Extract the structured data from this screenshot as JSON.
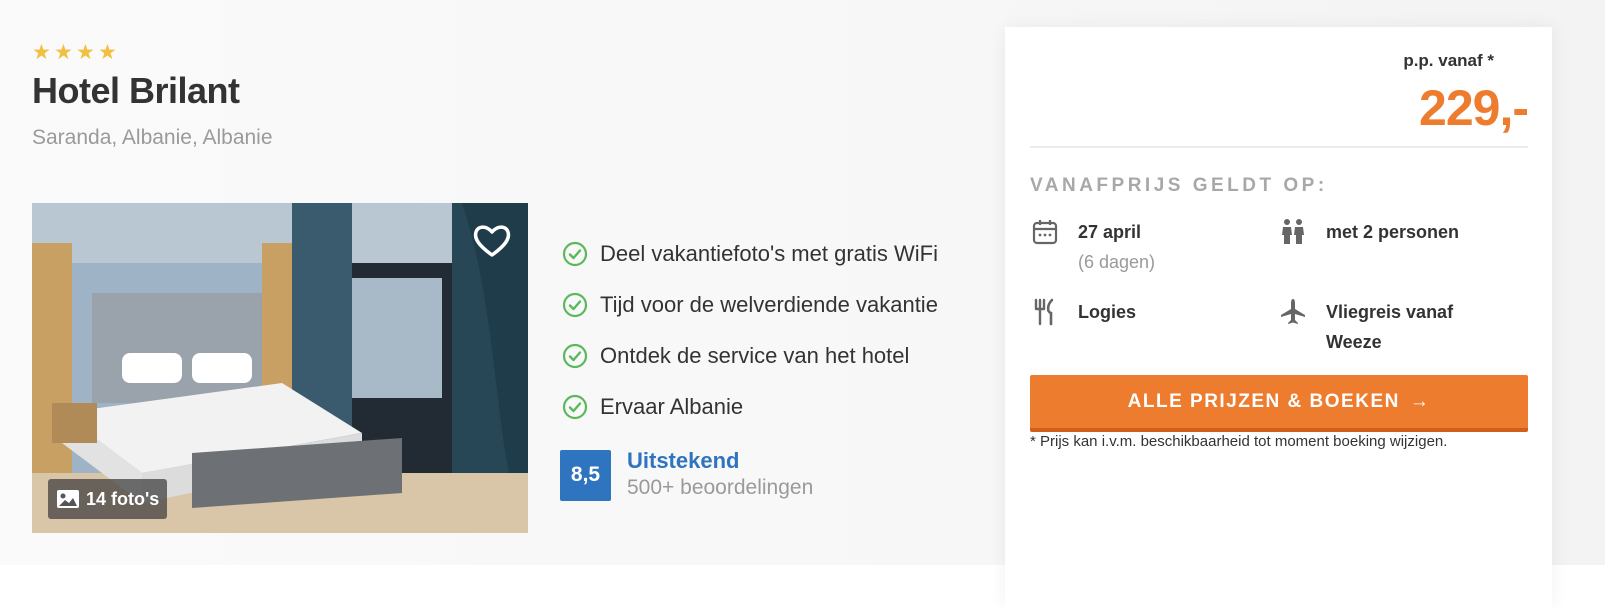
{
  "hotel": {
    "stars": 4,
    "name": "Hotel Brilant",
    "location": "Saranda, Albanie, Albanie",
    "photos_label": "14 foto's"
  },
  "features": [
    {
      "text": "Deel vakantiefoto's met gratis WiFi"
    },
    {
      "text": "Tijd voor de welverdiende vakantie"
    },
    {
      "text": "Ontdek de service van het hotel"
    },
    {
      "text": "Ervaar Albanie"
    }
  ],
  "rating": {
    "score": "8,5",
    "label": "Uitstekend",
    "count": "500+ beoordelingen"
  },
  "price_card": {
    "per_person": "p.p. vanaf *",
    "price": "229,-",
    "applies_heading": "VANAFPRIJS GELDT OP:",
    "date": "27 april",
    "duration": "(6 dagen)",
    "persons": "met 2 personen",
    "board": "Logies",
    "flight": "Vliegreis vanaf",
    "flight_origin": "Weeze",
    "book_label": "ALLE PRIJZEN & BOEKEN",
    "disclaimer": "* Prijs kan i.v.m. beschikbaarheid tot moment boeking wijzigen."
  },
  "colors": {
    "accent": "#ed7c2f",
    "rating_blue": "#2f74be",
    "star": "#f1c040",
    "check": "#5cb85c"
  },
  "icons": [
    "star-icon",
    "heart-icon",
    "image-icon",
    "check-circle-icon",
    "calendar-icon",
    "persons-icon",
    "cutlery-icon",
    "plane-icon",
    "arrow-right-icon"
  ]
}
